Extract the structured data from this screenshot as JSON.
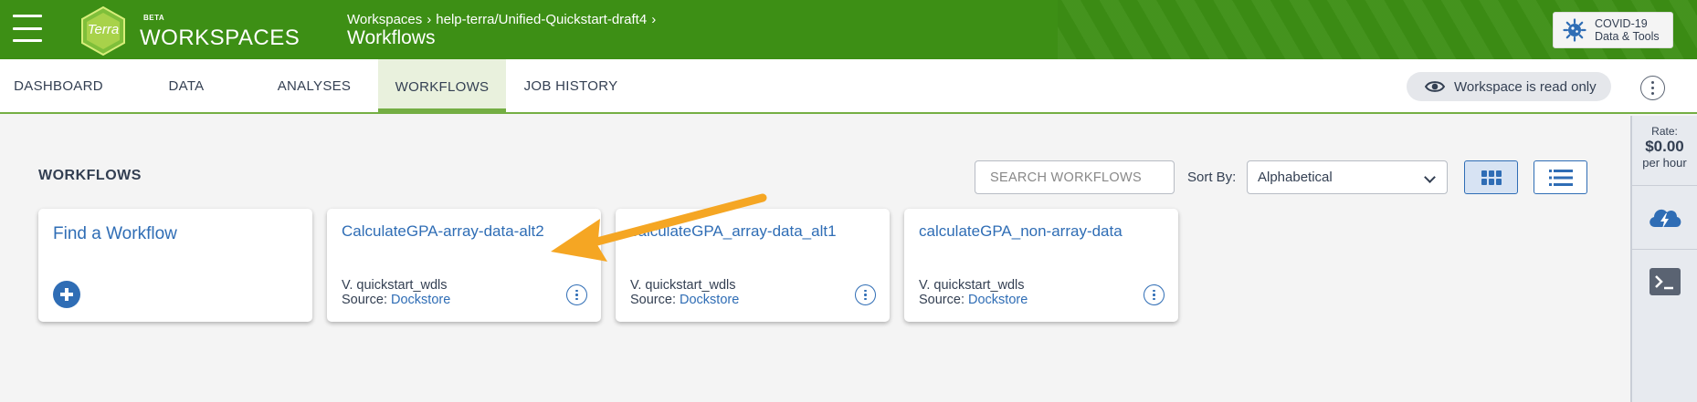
{
  "header": {
    "logo_text": "Terra",
    "beta": "BETA",
    "brand": "WORKSPACES",
    "breadcrumb": [
      "Workspaces",
      "help-terra/Unified-Quickstart-draft4"
    ],
    "title": "Workflows",
    "covid_button": {
      "line1": "COVID-19",
      "line2": "Data & Tools",
      "icon": "virus-icon"
    }
  },
  "tabs": [
    {
      "label": "DASHBOARD",
      "active": false
    },
    {
      "label": "DATA",
      "active": false
    },
    {
      "label": "ANALYSES",
      "active": false
    },
    {
      "label": "WORKFLOWS",
      "active": true
    },
    {
      "label": "JOB HISTORY",
      "active": false
    }
  ],
  "readonly_badge": "Workspace is read only",
  "rail": {
    "rate_label": "Rate:",
    "rate_value": "$0.00",
    "rate_unit": "per hour"
  },
  "main": {
    "section_title": "WORKFLOWS",
    "search_placeholder": "SEARCH WORKFLOWS",
    "sort_label": "Sort By:",
    "sort_value": "Alphabetical",
    "find_card_title": "Find a Workflow",
    "cards": [
      {
        "title": "CalculateGPA-array-data-alt2",
        "version": "V. quickstart_wdls",
        "source_label": "Source:",
        "source": "Dockstore"
      },
      {
        "title": "calculateGPA_array-data_alt1",
        "version": "V. quickstart_wdls",
        "source_label": "Source:",
        "source": "Dockstore"
      },
      {
        "title": "calculateGPA_non-array-data",
        "version": "V. quickstart_wdls",
        "source_label": "Source:",
        "source": "Dockstore"
      }
    ]
  },
  "colors": {
    "header_green": "#3d8f15",
    "accent_green": "#74ae43",
    "link_blue": "#2f6db5",
    "arrow_orange": "#f5a623"
  }
}
